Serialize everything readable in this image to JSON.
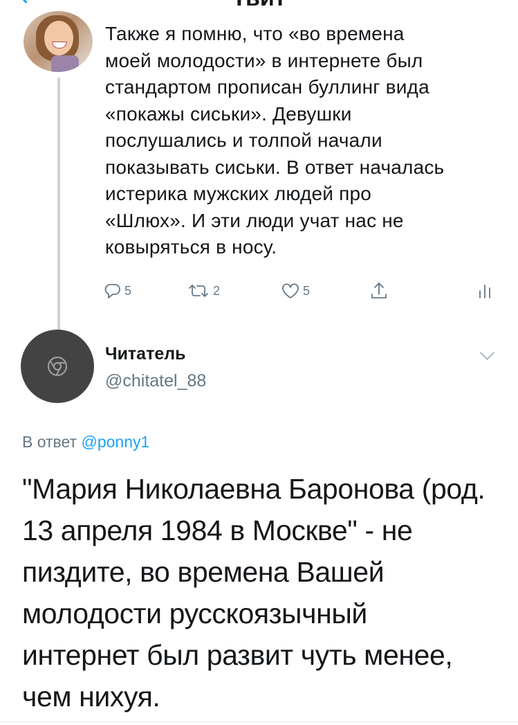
{
  "header": {
    "title": "Твит"
  },
  "tweet_parent": {
    "avatar_icon": "user-photo-avatar",
    "text": "Также я помню, что «во времена\nмоей молодости» в интернете был\nстандартом прописан буллинг вида\n«покажы сиськи». Девушки\nпослушались и толпой начали\nпоказывать сиськи. В ответ началась\nистерика мужских людей про\n«Шлюх». И эти люди учат нас не\nковыряться в носу.",
    "actions": {
      "replies": "5",
      "retweets": "2",
      "likes": "5"
    }
  },
  "tweet_main": {
    "author_name": "Читатель",
    "author_handle": "@chitatel_88",
    "avatar_icon": "chrome-icon",
    "reply_prefix": "В ответ",
    "reply_handle": "@ponny1",
    "text": "\"Мария Николаевна Баронова (род.\n13 апреля 1984 в Москве\" - не\nпиздите, во времена Вашей\nмолодости русскоязычный\nинтернет был развит чуть менее,\nчем нихуя."
  },
  "colors": {
    "accent": "#1da1f2",
    "secondary_text": "#657786",
    "thread_line": "#c8d2da"
  }
}
